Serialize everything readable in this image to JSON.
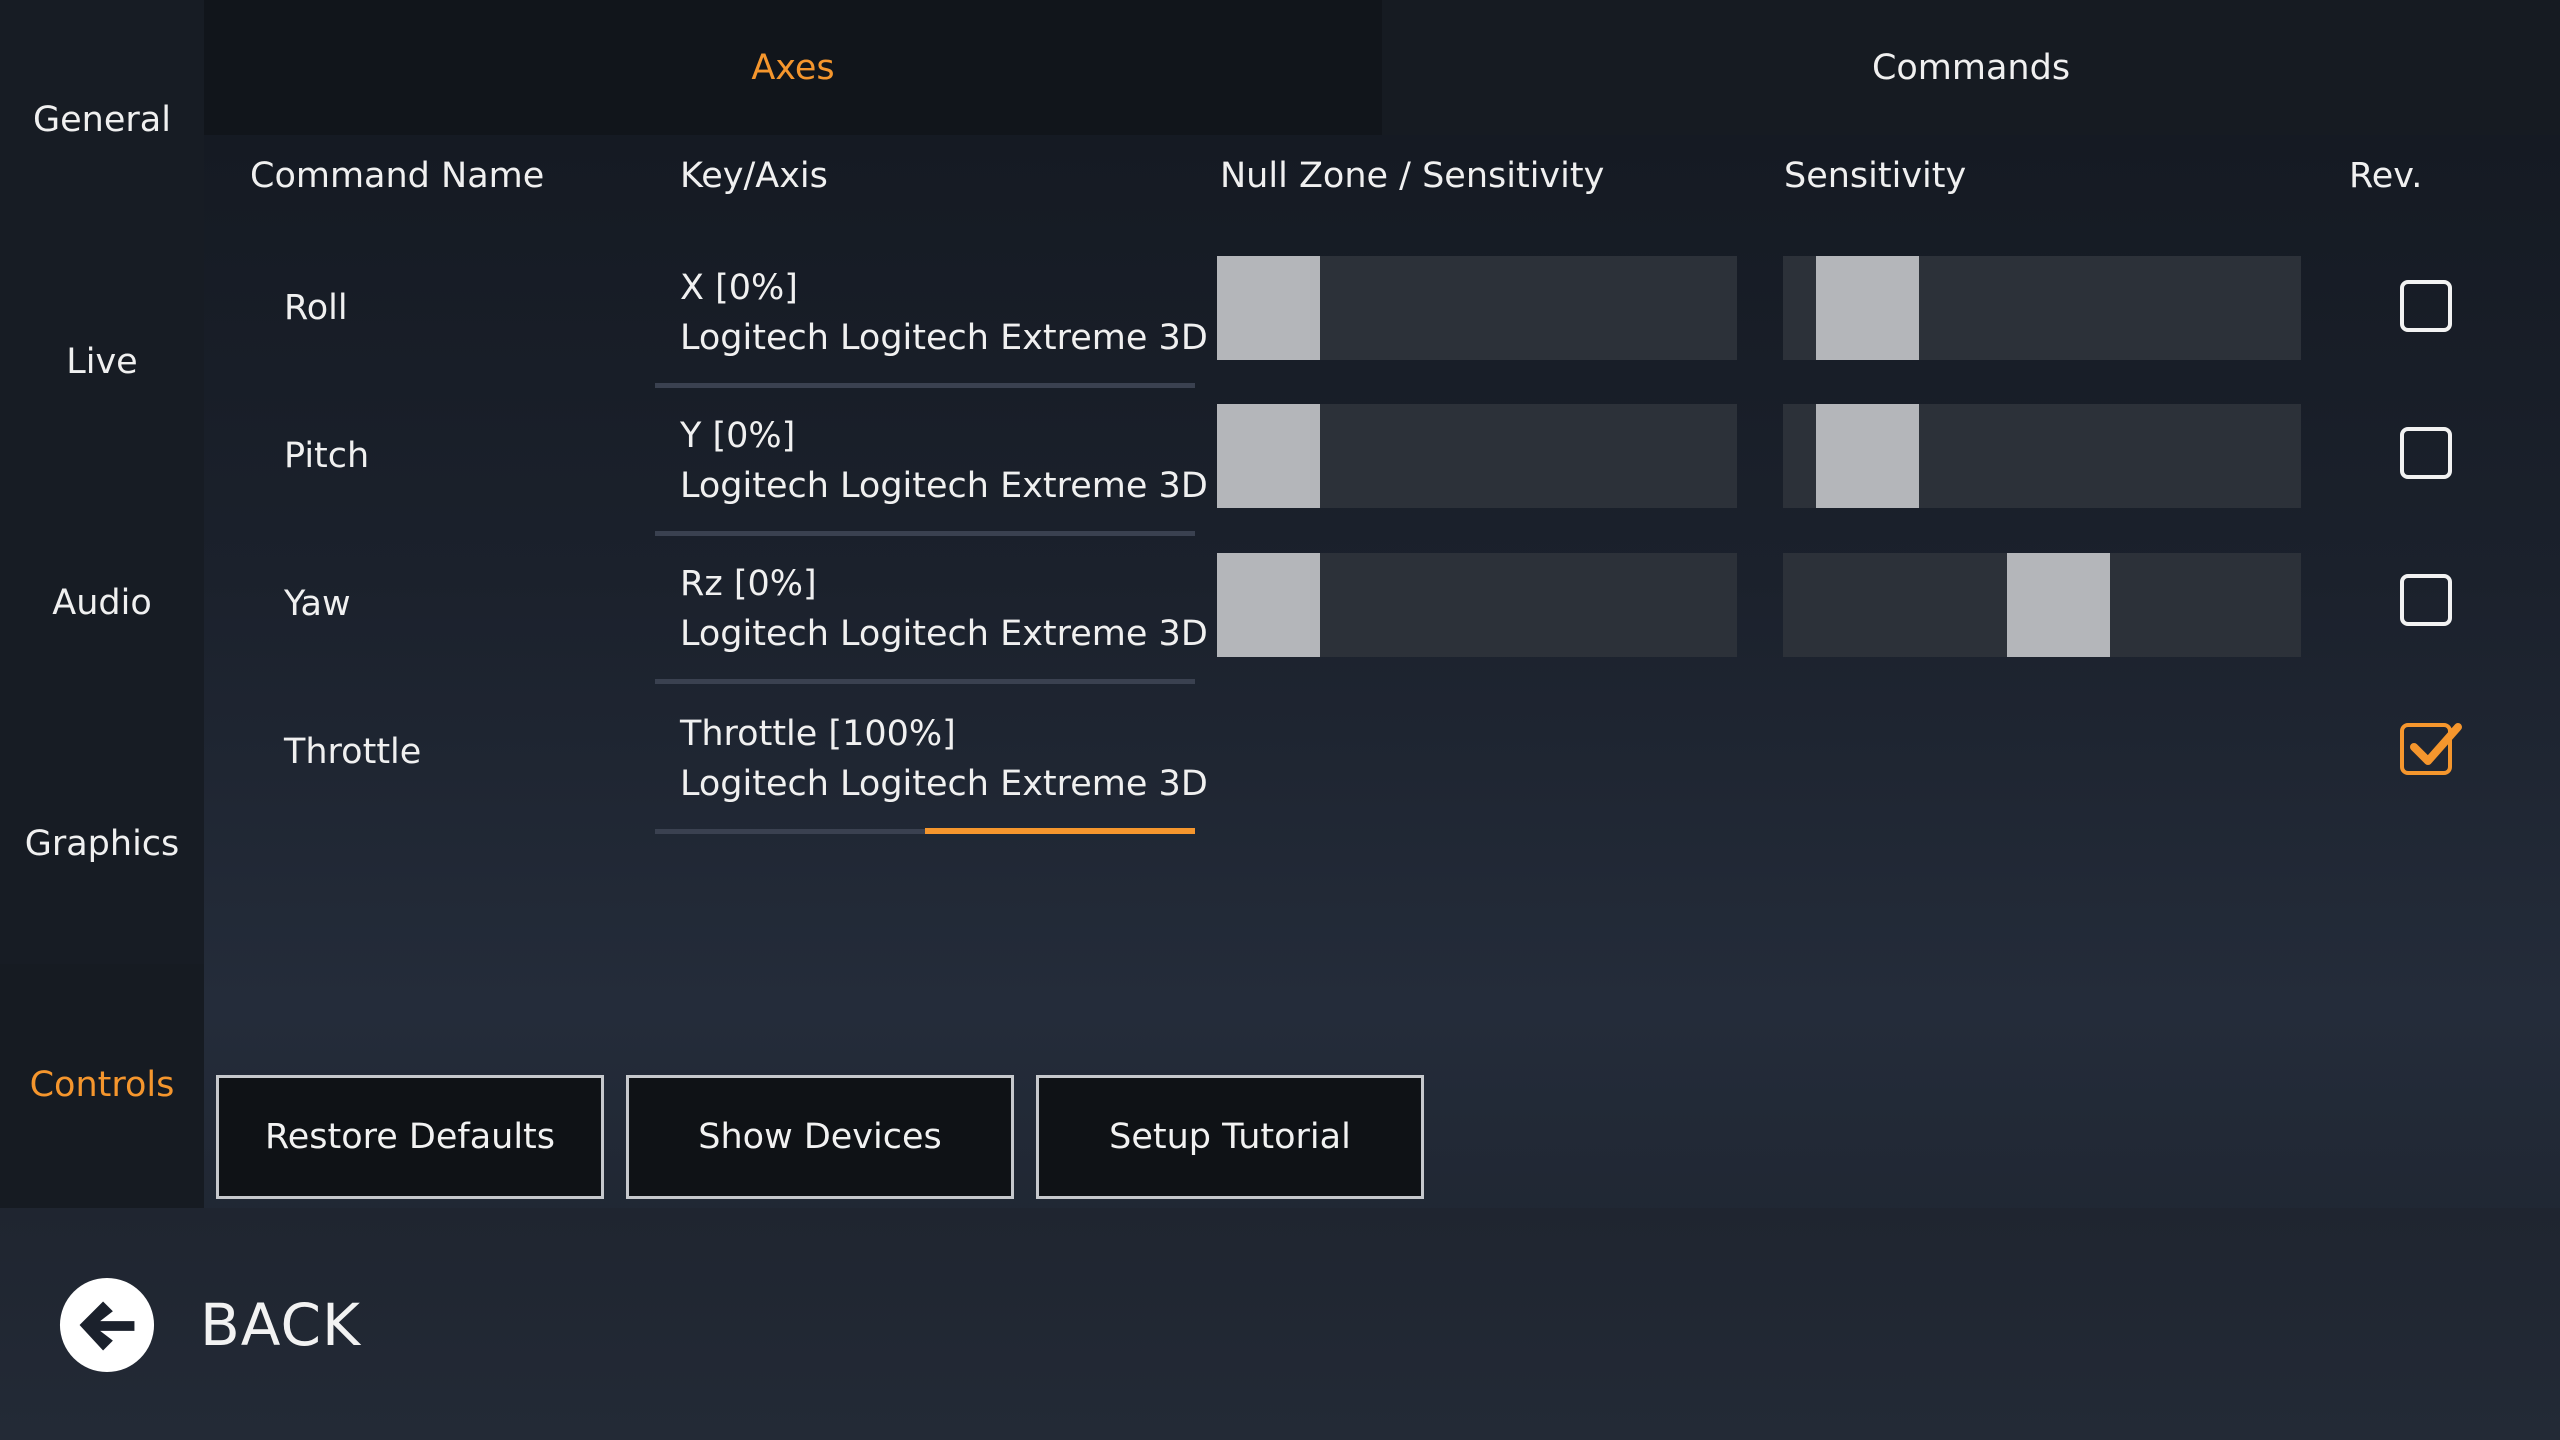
{
  "sidebar": {
    "items": [
      {
        "label": "General"
      },
      {
        "label": "Live"
      },
      {
        "label": "Audio"
      },
      {
        "label": "Graphics"
      },
      {
        "label": "Controls"
      }
    ],
    "active": "Controls"
  },
  "tabs": [
    {
      "label": "Axes",
      "active": true
    },
    {
      "label": "Commands",
      "active": false
    }
  ],
  "columns": {
    "command_name": "Command Name",
    "key_axis": "Key/Axis",
    "null_zone": "Null Zone / Sensitivity",
    "sensitivity": "Sensitivity",
    "rev": "Rev."
  },
  "rows": [
    {
      "name": "Roll",
      "axis": "X [0%]",
      "device": "Logitech Logitech Extreme 3D",
      "null_zone": 0.0,
      "sensitivity": 0.08,
      "reversed": false
    },
    {
      "name": "Pitch",
      "axis": "Y [0%]",
      "device": "Logitech Logitech Extreme 3D",
      "null_zone": 0.0,
      "sensitivity": 0.08,
      "reversed": false
    },
    {
      "name": "Yaw",
      "axis": "Rz [0%]",
      "device": "Logitech Logitech Extreme 3D",
      "null_zone": 0.0,
      "sensitivity": 0.54,
      "reversed": false
    },
    {
      "name": "Throttle",
      "axis": "Throttle [100%]",
      "device": "Logitech Logitech Extreme 3D",
      "reversed": true
    }
  ],
  "buttons": {
    "restore_defaults": "Restore Defaults",
    "show_devices": "Show Devices",
    "setup_tutorial": "Setup Tutorial"
  },
  "back": {
    "label": "BACK",
    "icon": "back-arrow-icon"
  },
  "colors": {
    "accent": "#f5962d",
    "slider_track": "#2c3139",
    "slider_thumb": "#b4b6ba"
  }
}
